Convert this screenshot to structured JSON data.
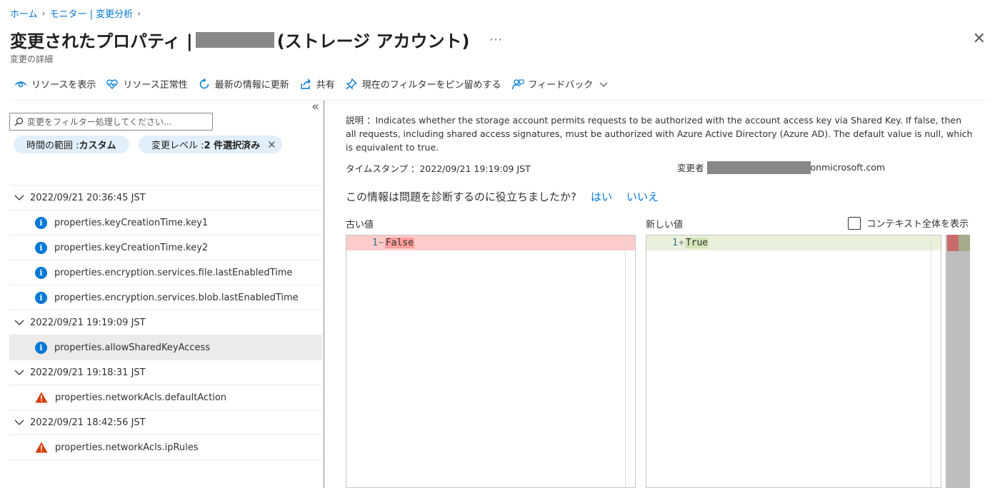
{
  "breadcrumb": {
    "home": "ホーム",
    "monitor": "モニター | 変更分析"
  },
  "header": {
    "title_prefix": "変更されたプロパティ |",
    "title_suffix": "(ストレージ アカウント)",
    "more": "···",
    "close": "✕",
    "subtitle": "変更の詳細"
  },
  "toolbar": {
    "view_resource": "リソースを表示",
    "resource_health": "リソース正常性",
    "refresh": "最新の情報に更新",
    "share": "共有",
    "pin": "現在のフィルターをピン留めする",
    "feedback": "フィードバック"
  },
  "filter": {
    "search_placeholder": "変更をフィルター処理してください...",
    "time_range_label": "時間の範囲 : ",
    "time_range_value": "カスタム",
    "change_level_label": "変更レベル : ",
    "change_level_value": "2 件選択済み"
  },
  "groups": [
    {
      "timestamp": "2022/09/21 20:36:45 JST",
      "items": [
        {
          "label": "properties.keyCreationTime.key1",
          "icon": "info"
        },
        {
          "label": "properties.keyCreationTime.key2",
          "icon": "info"
        },
        {
          "label": "properties.encryption.services.file.lastEnabledTime",
          "icon": "info"
        },
        {
          "label": "properties.encryption.services.blob.lastEnabledTime",
          "icon": "info"
        }
      ]
    },
    {
      "timestamp": "2022/09/21 19:19:09 JST",
      "items": [
        {
          "label": "properties.allowSharedKeyAccess",
          "icon": "info",
          "selected": true
        }
      ]
    },
    {
      "timestamp": "2022/09/21 19:18:31 JST",
      "items": [
        {
          "label": "properties.networkAcls.defaultAction",
          "icon": "warning"
        }
      ]
    },
    {
      "timestamp": "2022/09/21 18:42:56 JST",
      "items": [
        {
          "label": "properties.networkAcls.ipRules",
          "icon": "warning"
        }
      ]
    }
  ],
  "detail": {
    "description": "説明 ：Indicates whether the storage account permits requests to be authorized with the account access key via Shared Key. If false, then all requests, including shared access signatures, must be authorized with Azure Active Directory (Azure AD). The default value is null, which is equivalent to true.",
    "timestamp": "タイムスタンプ ：2022/09/21 19:19:09 JST",
    "changed_by_label": "変更者",
    "changed_by_suffix": "onmicrosoft.com",
    "feedback_question": "この情報は問題を診断するのに役立ちましたか?",
    "yes": "はい",
    "no": "いいえ",
    "old_label": "古い値",
    "new_label": "新しい値",
    "show_context": "コンテキスト全体を表示",
    "old_line_no": "1",
    "old_mark": "−",
    "old_value": "False",
    "new_line_no": "1",
    "new_mark": "+",
    "new_value": "True"
  },
  "colors": {
    "accent": "#0078d4",
    "deleted": "#ffcccc",
    "added": "#e9f0dc",
    "warning": "#d83b01"
  }
}
